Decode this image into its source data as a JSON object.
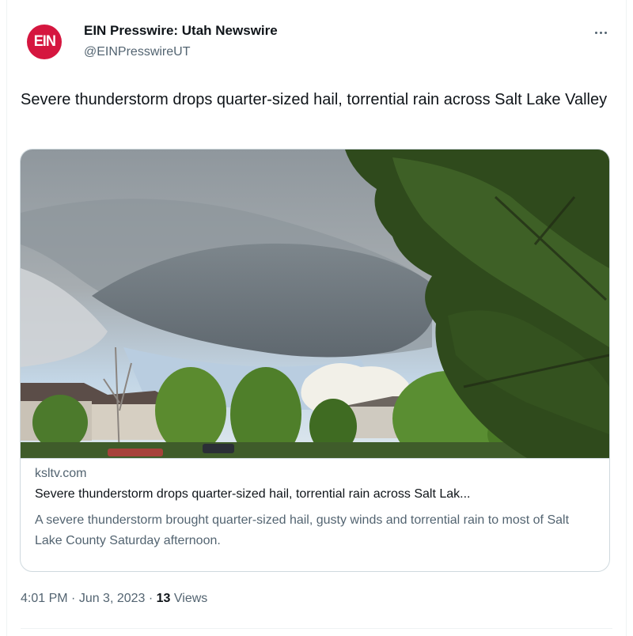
{
  "author": {
    "avatar_text": "EIN",
    "display_name": "EIN Presswire: Utah Newswire",
    "handle": "@EINPresswireUT",
    "avatar_color": "#d5163f"
  },
  "more_icon": "more-horizontal-icon",
  "tweet": {
    "text": "Severe thunderstorm drops quarter-sized hail, torrential rain across Salt Lake Valley"
  },
  "card": {
    "domain": "ksltv.com",
    "title": "Severe thunderstorm drops quarter-sized hail, torrential rain across Salt Lak...",
    "description": "A severe thunderstorm brought quarter-sized hail, gusty winds and torrential rain to most of Salt Lake County Saturday afternoon."
  },
  "meta": {
    "time": "4:01 PM",
    "separator": " · ",
    "date": "Jun 3, 2023",
    "views_count": "13",
    "views_label": " Views"
  },
  "colors": {
    "primary_text": "#0f1419",
    "secondary_text": "#536471",
    "border": "#cfd9de"
  }
}
